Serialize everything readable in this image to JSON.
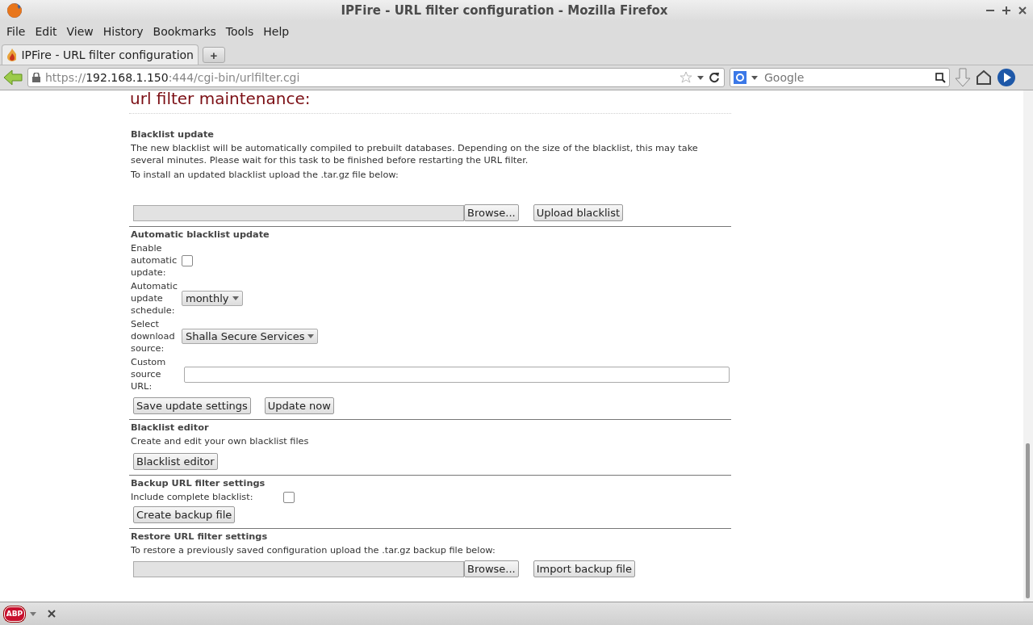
{
  "window": {
    "title": "IPFire - URL filter configuration - Mozilla Firefox"
  },
  "menu": [
    "File",
    "Edit",
    "View",
    "History",
    "Bookmarks",
    "Tools",
    "Help"
  ],
  "tabs": [
    {
      "label": "IPFire - URL filter configuration",
      "selected": true
    }
  ],
  "new_tab": "+",
  "address": {
    "scheme": "https://",
    "host": "192.168.1.150",
    "path": ":444/cgi-bin/urlfilter.cgi"
  },
  "search": {
    "placeholder": "Google"
  },
  "page": {
    "heading": "url filter maintenance:",
    "sections": [
      {
        "title": "Blacklist update",
        "items": [
          {
            "kind": "text",
            "text": "The new blacklist will be automatically compiled to prebuilt databases. Depending on the size of the blacklist, this may take several minutes. Please wait for this task to be finished before restarting the URL filter."
          },
          {
            "kind": "text",
            "text": "To install an updated blacklist upload the .tar.gz file below:"
          },
          {
            "kind": "upload",
            "browse": "Browse...",
            "button": "Upload blacklist"
          }
        ]
      },
      {
        "title": "Automatic blacklist update",
        "items": [
          {
            "kind": "checkbox",
            "label": "Enable automatic update:",
            "checked": false
          },
          {
            "kind": "select",
            "label": "Automatic update schedule:",
            "value": "monthly"
          },
          {
            "kind": "select",
            "label": "Select download source:",
            "value": "Shalla Secure Services"
          },
          {
            "kind": "input",
            "label": "Custom source URL:"
          },
          {
            "kind": "buttons",
            "buttons": [
              "Save update settings",
              "Update now"
            ]
          }
        ]
      },
      {
        "title": "Blacklist editor",
        "items": [
          {
            "kind": "text",
            "text": "Create and edit your own blacklist files"
          },
          {
            "kind": "buttons",
            "buttons": [
              "Blacklist editor"
            ]
          }
        ]
      },
      {
        "title": "Backup URL filter settings",
        "items": [
          {
            "kind": "inline_checkbox",
            "label": "Include complete blacklist:",
            "checked": false
          },
          {
            "kind": "buttons",
            "buttons": [
              "Create backup file"
            ]
          }
        ]
      },
      {
        "title": "Restore URL filter settings",
        "items": [
          {
            "kind": "text",
            "text": "To restore a previously saved configuration upload the .tar.gz backup file below:"
          },
          {
            "kind": "upload",
            "browse": "Browse...",
            "button": "Import backup file"
          }
        ]
      }
    ]
  },
  "status_bar": {
    "adblock_label": "ABP"
  }
}
